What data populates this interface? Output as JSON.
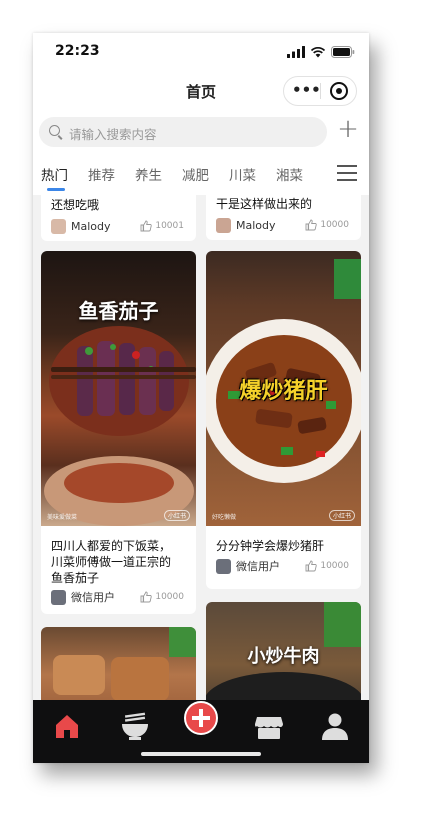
{
  "status_bar": {
    "time": "22:23"
  },
  "navbar": {
    "title": "首页",
    "more_glyph": "•••"
  },
  "search": {
    "placeholder": "请输入搜索内容"
  },
  "tabs": [
    {
      "label": "热门",
      "active": true
    },
    {
      "label": "推荐",
      "active": false
    },
    {
      "label": "养生",
      "active": false
    },
    {
      "label": "减肥",
      "active": false
    },
    {
      "label": "川菜",
      "active": false
    },
    {
      "label": "湘菜",
      "active": false
    }
  ],
  "feed": {
    "cards": [
      {
        "id": "c1",
        "title": "还想吃哦",
        "author": "Malody",
        "likes": "10001"
      },
      {
        "id": "c2",
        "title": "干是这样做出来的",
        "author": "Malody",
        "likes": "10000"
      },
      {
        "id": "c3",
        "overlay_text": "鱼香茄子",
        "watermark_left": "美味爱做菜",
        "watermark_right": "小红书",
        "title_lines": [
          "四川人都爱的下饭菜，",
          "川菜师傅做一道正宗的",
          "鱼香茄子"
        ],
        "author": "微信用户",
        "likes": "10000"
      },
      {
        "id": "c4",
        "overlay_text": "爆炒猪肝",
        "watermark_left": "好吃懒做",
        "watermark_right": "小红书",
        "title_lines": [
          "分分钟学会爆炒猪肝"
        ],
        "author": "微信用户",
        "likes": "10000"
      },
      {
        "id": "c5"
      },
      {
        "id": "c6",
        "overlay_text": "小炒牛肉"
      }
    ]
  },
  "tabbar": {
    "items": [
      "home-icon",
      "bowl-icon",
      "add-icon",
      "store-icon",
      "profile-icon"
    ],
    "active_color": "#e8494a"
  },
  "colors": {
    "accent": "#3b86e8",
    "tabbar_bg": "#0f0f10",
    "active_icon": "#e8494a"
  }
}
